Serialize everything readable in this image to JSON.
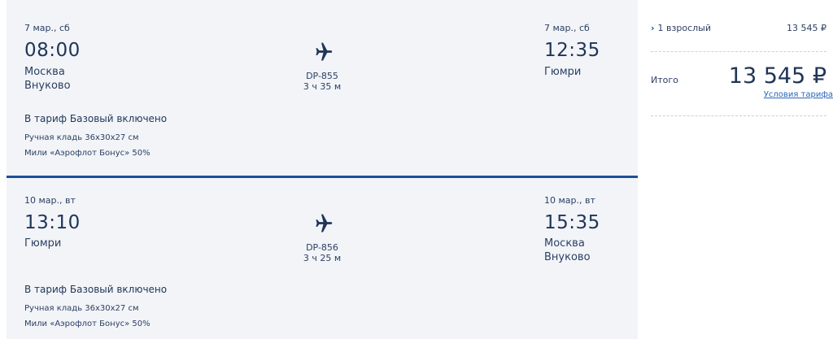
{
  "flights": [
    {
      "depart_date": "7 мар., сб",
      "depart_time": "08:00",
      "depart_city": "Москва",
      "depart_airport": "Внуково",
      "flight_no": "DP-855",
      "duration": "3 ч 35 м",
      "arrive_date": "7 мар., сб",
      "arrive_time": "12:35",
      "arrive_city": "Гюмри",
      "arrive_airport": "",
      "tariff_title": "В тариф Базовый включено",
      "tariff_items": [
        "Ручная кладь 36x30x27 см",
        "Мили «Аэрофлот Бонус» 50%"
      ]
    },
    {
      "depart_date": "10 мар., вт",
      "depart_time": "13:10",
      "depart_city": "Гюмри",
      "depart_airport": "",
      "flight_no": "DP-856",
      "duration": "3 ч 25 м",
      "arrive_date": "10 мар., вт",
      "arrive_time": "15:35",
      "arrive_city": "Москва",
      "arrive_airport": "Внуково",
      "tariff_title": "В тариф Базовый включено",
      "tariff_items": [
        "Ручная кладь 36x30x27 см",
        "Мили «Аэрофлот Бонус» 50%"
      ]
    }
  ],
  "summary": {
    "passengers_label": "1 взрослый",
    "passengers_price": "13 545 ₽",
    "total_label": "Итого",
    "total_price": "13 545 ₽",
    "tariff_link": "Условия тарифа"
  },
  "icons": {
    "plane": "airplane-icon",
    "chevron": "chevron-right-icon"
  },
  "colors": {
    "accent": "#1f4f97",
    "card_bg": "#f2f4f8",
    "text": "#1f3557",
    "link": "#2a66b8"
  }
}
